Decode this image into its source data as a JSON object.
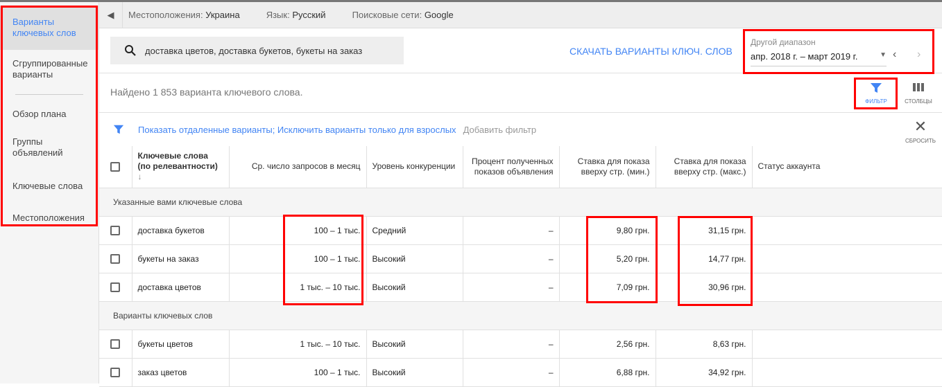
{
  "sidebar": {
    "items": [
      {
        "label": "Варианты ключевых слов"
      },
      {
        "label": "Сгруппированные варианты"
      },
      {
        "label": "Обзор плана"
      },
      {
        "label": "Группы объявлений"
      },
      {
        "label": "Ключевые слова"
      },
      {
        "label": "Местоположения"
      }
    ]
  },
  "topbar": {
    "locations_label": "Местоположения:",
    "locations": "Украина",
    "language_label": "Язык:",
    "language": "Русский",
    "networks_label": "Поисковые сети:",
    "networks": "Google"
  },
  "search": {
    "value": "доставка цветов, доставка букетов, букеты на заказ"
  },
  "download": "СКАЧАТЬ ВАРИАНТЫ КЛЮЧ. СЛОВ",
  "range": {
    "label": "Другой диапазон",
    "value": "апр. 2018 г. – март 2019 г."
  },
  "count": "Найдено 1 853 варианта ключевого слова.",
  "tools": {
    "filter": "ФИЛЬТР",
    "columns": "СТОЛБЦЫ",
    "reset": "СБРОСИТЬ"
  },
  "filters": {
    "active": "Показать отдаленные варианты; Исключить варианты только для взрослых",
    "add": "Добавить фильтр"
  },
  "columns": [
    "Ключевые слова (по релевантности)",
    "Ср. число запросов в месяц",
    "Уровень конкуренции",
    "Процент полученных показов объявления",
    "Ставка для показа вверху стр. (мин.)",
    "Ставка для показа вверху стр. (макс.)",
    "Статус аккаунта"
  ],
  "groups": [
    {
      "title": "Указанные вами ключевые слова",
      "rows": [
        {
          "kw": "доставка букетов",
          "avg": "100 – 1 тыс.",
          "comp": "Средний",
          "pct": "–",
          "min": "9,80 грн.",
          "max": "31,15 грн."
        },
        {
          "kw": "букеты на заказ",
          "avg": "100 – 1 тыс.",
          "comp": "Высокий",
          "pct": "–",
          "min": "5,20 грн.",
          "max": "14,77 грн."
        },
        {
          "kw": "доставка цветов",
          "avg": "1 тыс. – 10 тыс.",
          "comp": "Высокий",
          "pct": "–",
          "min": "7,09 грн.",
          "max": "30,96 грн."
        }
      ]
    },
    {
      "title": "Варианты ключевых слов",
      "rows": [
        {
          "kw": "букеты цветов",
          "avg": "1 тыс. – 10 тыс.",
          "comp": "Высокий",
          "pct": "–",
          "min": "2,56 грн.",
          "max": "8,63 грн."
        },
        {
          "kw": "заказ цветов",
          "avg": "100 – 1 тыс.",
          "comp": "Высокий",
          "pct": "–",
          "min": "6,88 грн.",
          "max": "34,92 грн."
        }
      ]
    }
  ]
}
